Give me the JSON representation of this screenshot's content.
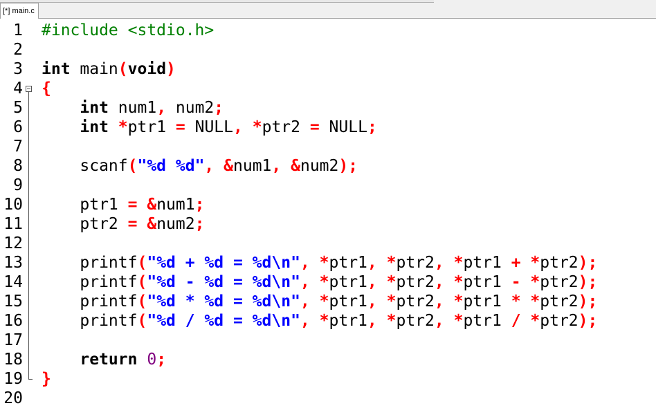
{
  "tab": {
    "label": "[*] main.c"
  },
  "editor": {
    "lines": [
      {
        "n": "1",
        "tokens": [
          {
            "t": "#include <stdio.h>",
            "c": "pp"
          }
        ]
      },
      {
        "n": "2",
        "tokens": []
      },
      {
        "n": "3",
        "tokens": [
          {
            "t": "int",
            "c": "kw"
          },
          {
            "t": " main",
            "c": ""
          },
          {
            "t": "(",
            "c": "sym"
          },
          {
            "t": "void",
            "c": "kw"
          },
          {
            "t": ")",
            "c": "sym"
          }
        ]
      },
      {
        "n": "4",
        "tokens": [
          {
            "t": "{",
            "c": "sym"
          }
        ],
        "fold": "open"
      },
      {
        "n": "5",
        "tokens": [
          {
            "t": "    ",
            "c": ""
          },
          {
            "t": "int",
            "c": "kw"
          },
          {
            "t": " num1",
            "c": ""
          },
          {
            "t": ",",
            "c": "sym"
          },
          {
            "t": " num2",
            "c": ""
          },
          {
            "t": ";",
            "c": "sym"
          }
        ]
      },
      {
        "n": "6",
        "tokens": [
          {
            "t": "    ",
            "c": ""
          },
          {
            "t": "int",
            "c": "kw"
          },
          {
            "t": " ",
            "c": ""
          },
          {
            "t": "*",
            "c": "sym"
          },
          {
            "t": "ptr1 ",
            "c": ""
          },
          {
            "t": "=",
            "c": "sym"
          },
          {
            "t": " NULL",
            "c": ""
          },
          {
            "t": ",",
            "c": "sym"
          },
          {
            "t": " ",
            "c": ""
          },
          {
            "t": "*",
            "c": "sym"
          },
          {
            "t": "ptr2 ",
            "c": ""
          },
          {
            "t": "=",
            "c": "sym"
          },
          {
            "t": " NULL",
            "c": ""
          },
          {
            "t": ";",
            "c": "sym"
          }
        ]
      },
      {
        "n": "7",
        "tokens": []
      },
      {
        "n": "8",
        "tokens": [
          {
            "t": "    scanf",
            "c": ""
          },
          {
            "t": "(",
            "c": "sym"
          },
          {
            "t": "\"%d %d\"",
            "c": "str"
          },
          {
            "t": ",",
            "c": "sym"
          },
          {
            "t": " ",
            "c": ""
          },
          {
            "t": "&",
            "c": "sym"
          },
          {
            "t": "num1",
            "c": ""
          },
          {
            "t": ",",
            "c": "sym"
          },
          {
            "t": " ",
            "c": ""
          },
          {
            "t": "&",
            "c": "sym"
          },
          {
            "t": "num2",
            "c": ""
          },
          {
            "t": ");",
            "c": "sym"
          }
        ]
      },
      {
        "n": "9",
        "tokens": []
      },
      {
        "n": "10",
        "tokens": [
          {
            "t": "    ptr1 ",
            "c": ""
          },
          {
            "t": "=",
            "c": "sym"
          },
          {
            "t": " ",
            "c": ""
          },
          {
            "t": "&",
            "c": "sym"
          },
          {
            "t": "num1",
            "c": ""
          },
          {
            "t": ";",
            "c": "sym"
          }
        ]
      },
      {
        "n": "11",
        "tokens": [
          {
            "t": "    ptr2 ",
            "c": ""
          },
          {
            "t": "=",
            "c": "sym"
          },
          {
            "t": " ",
            "c": ""
          },
          {
            "t": "&",
            "c": "sym"
          },
          {
            "t": "num2",
            "c": ""
          },
          {
            "t": ";",
            "c": "sym"
          }
        ]
      },
      {
        "n": "12",
        "tokens": []
      },
      {
        "n": "13",
        "tokens": [
          {
            "t": "    printf",
            "c": ""
          },
          {
            "t": "(",
            "c": "sym"
          },
          {
            "t": "\"%d + %d = %d",
            "c": "str"
          },
          {
            "t": "\\n",
            "c": "esc"
          },
          {
            "t": "\"",
            "c": "str"
          },
          {
            "t": ",",
            "c": "sym"
          },
          {
            "t": " ",
            "c": ""
          },
          {
            "t": "*",
            "c": "sym"
          },
          {
            "t": "ptr1",
            "c": ""
          },
          {
            "t": ",",
            "c": "sym"
          },
          {
            "t": " ",
            "c": ""
          },
          {
            "t": "*",
            "c": "sym"
          },
          {
            "t": "ptr2",
            "c": ""
          },
          {
            "t": ",",
            "c": "sym"
          },
          {
            "t": " ",
            "c": ""
          },
          {
            "t": "*",
            "c": "sym"
          },
          {
            "t": "ptr1 ",
            "c": ""
          },
          {
            "t": "+",
            "c": "sym"
          },
          {
            "t": " ",
            "c": ""
          },
          {
            "t": "*",
            "c": "sym"
          },
          {
            "t": "ptr2",
            "c": ""
          },
          {
            "t": ");",
            "c": "sym"
          }
        ]
      },
      {
        "n": "14",
        "tokens": [
          {
            "t": "    printf",
            "c": ""
          },
          {
            "t": "(",
            "c": "sym"
          },
          {
            "t": "\"%d - %d = %d",
            "c": "str"
          },
          {
            "t": "\\n",
            "c": "esc"
          },
          {
            "t": "\"",
            "c": "str"
          },
          {
            "t": ",",
            "c": "sym"
          },
          {
            "t": " ",
            "c": ""
          },
          {
            "t": "*",
            "c": "sym"
          },
          {
            "t": "ptr1",
            "c": ""
          },
          {
            "t": ",",
            "c": "sym"
          },
          {
            "t": " ",
            "c": ""
          },
          {
            "t": "*",
            "c": "sym"
          },
          {
            "t": "ptr2",
            "c": ""
          },
          {
            "t": ",",
            "c": "sym"
          },
          {
            "t": " ",
            "c": ""
          },
          {
            "t": "*",
            "c": "sym"
          },
          {
            "t": "ptr1 ",
            "c": ""
          },
          {
            "t": "-",
            "c": "sym"
          },
          {
            "t": " ",
            "c": ""
          },
          {
            "t": "*",
            "c": "sym"
          },
          {
            "t": "ptr2",
            "c": ""
          },
          {
            "t": ");",
            "c": "sym"
          }
        ]
      },
      {
        "n": "15",
        "tokens": [
          {
            "t": "    printf",
            "c": ""
          },
          {
            "t": "(",
            "c": "sym"
          },
          {
            "t": "\"%d * %d = %d",
            "c": "str"
          },
          {
            "t": "\\n",
            "c": "esc"
          },
          {
            "t": "\"",
            "c": "str"
          },
          {
            "t": ",",
            "c": "sym"
          },
          {
            "t": " ",
            "c": ""
          },
          {
            "t": "*",
            "c": "sym"
          },
          {
            "t": "ptr1",
            "c": ""
          },
          {
            "t": ",",
            "c": "sym"
          },
          {
            "t": " ",
            "c": ""
          },
          {
            "t": "*",
            "c": "sym"
          },
          {
            "t": "ptr2",
            "c": ""
          },
          {
            "t": ",",
            "c": "sym"
          },
          {
            "t": " ",
            "c": ""
          },
          {
            "t": "*",
            "c": "sym"
          },
          {
            "t": "ptr1 ",
            "c": ""
          },
          {
            "t": "*",
            "c": "sym"
          },
          {
            "t": " ",
            "c": ""
          },
          {
            "t": "*",
            "c": "sym"
          },
          {
            "t": "ptr2",
            "c": ""
          },
          {
            "t": ");",
            "c": "sym"
          }
        ]
      },
      {
        "n": "16",
        "tokens": [
          {
            "t": "    printf",
            "c": ""
          },
          {
            "t": "(",
            "c": "sym"
          },
          {
            "t": "\"%d / %d = %d",
            "c": "str"
          },
          {
            "t": "\\n",
            "c": "esc"
          },
          {
            "t": "\"",
            "c": "str"
          },
          {
            "t": ",",
            "c": "sym"
          },
          {
            "t": " ",
            "c": ""
          },
          {
            "t": "*",
            "c": "sym"
          },
          {
            "t": "ptr1",
            "c": ""
          },
          {
            "t": ",",
            "c": "sym"
          },
          {
            "t": " ",
            "c": ""
          },
          {
            "t": "*",
            "c": "sym"
          },
          {
            "t": "ptr2",
            "c": ""
          },
          {
            "t": ",",
            "c": "sym"
          },
          {
            "t": " ",
            "c": ""
          },
          {
            "t": "*",
            "c": "sym"
          },
          {
            "t": "ptr1 ",
            "c": ""
          },
          {
            "t": "/",
            "c": "sym"
          },
          {
            "t": " ",
            "c": ""
          },
          {
            "t": "*",
            "c": "sym"
          },
          {
            "t": "ptr2",
            "c": ""
          },
          {
            "t": ");",
            "c": "sym"
          }
        ]
      },
      {
        "n": "17",
        "tokens": []
      },
      {
        "n": "18",
        "tokens": [
          {
            "t": "    ",
            "c": ""
          },
          {
            "t": "return",
            "c": "kw"
          },
          {
            "t": " ",
            "c": ""
          },
          {
            "t": "0",
            "c": "num"
          },
          {
            "t": ";",
            "c": "sym"
          }
        ]
      },
      {
        "n": "19",
        "tokens": [
          {
            "t": "}",
            "c": "sym"
          }
        ],
        "fold": "end"
      },
      {
        "n": "20",
        "tokens": []
      }
    ]
  }
}
